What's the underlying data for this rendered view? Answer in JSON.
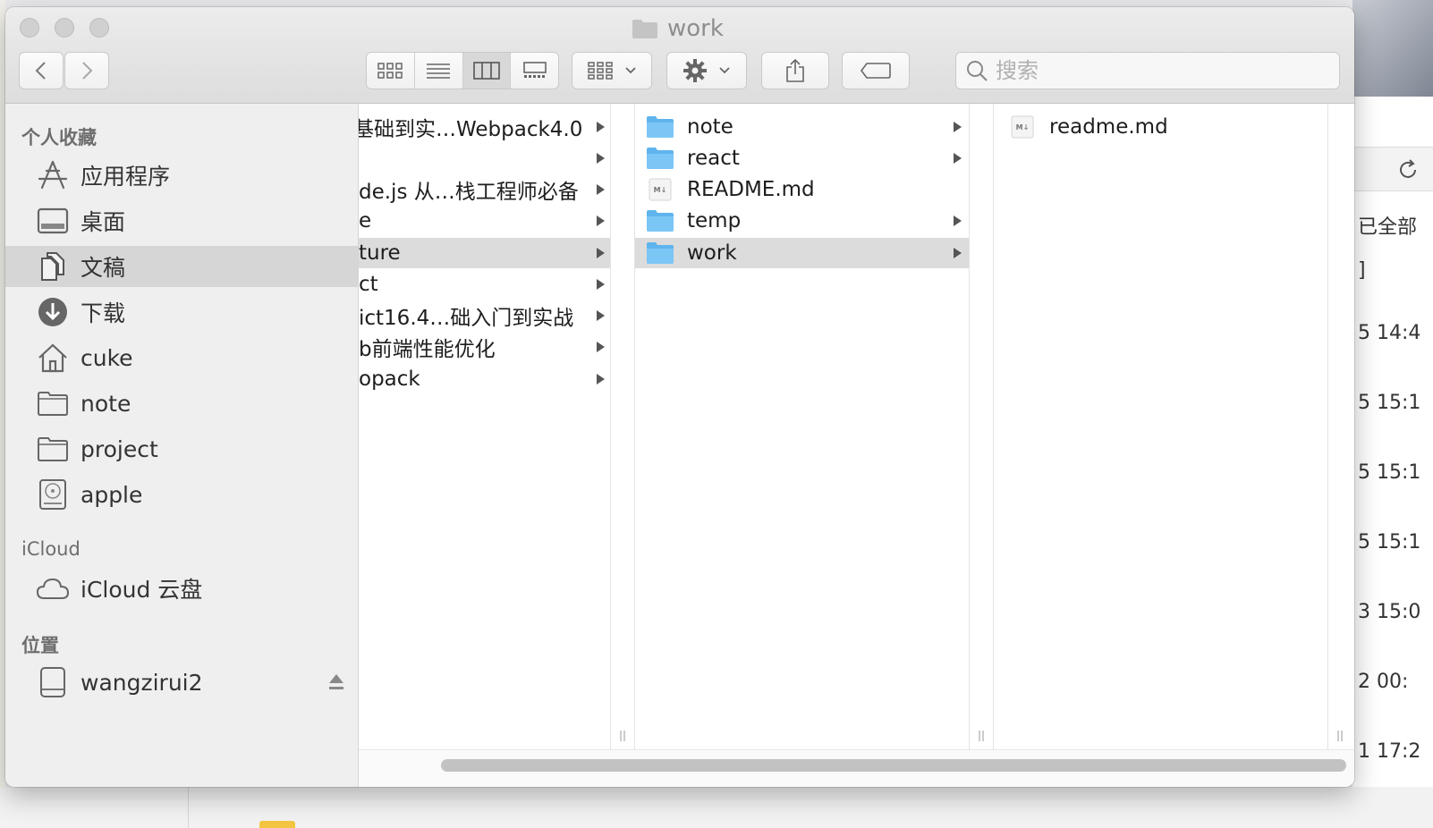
{
  "window": {
    "title": "work",
    "search_placeholder": "搜索"
  },
  "sidebar": {
    "favorites_header": "个人收藏",
    "favorites": [
      {
        "label": "应用程序",
        "icon": "applications-icon"
      },
      {
        "label": "桌面",
        "icon": "desktop-icon"
      },
      {
        "label": "文稿",
        "icon": "documents-icon",
        "selected": true
      },
      {
        "label": "下载",
        "icon": "downloads-icon"
      },
      {
        "label": "cuke",
        "icon": "home-icon"
      },
      {
        "label": "note",
        "icon": "folder-icon"
      },
      {
        "label": "project",
        "icon": "folder-icon"
      },
      {
        "label": "apple",
        "icon": "hard-drive-icon"
      }
    ],
    "icloud_header": "iCloud",
    "icloud": [
      {
        "label": "iCloud 云盘",
        "icon": "cloud-icon"
      }
    ],
    "locations_header": "位置",
    "locations": [
      {
        "label": "wangzirui2",
        "icon": "external-drive-icon"
      }
    ]
  },
  "columns": [
    {
      "items": [
        {
          "name": "基础到实…Webpack4.0",
          "arrow": true
        },
        {
          "name": "",
          "arrow": true
        },
        {
          "name": "de.js 从…栈工程师必备",
          "arrow": true
        },
        {
          "name": "e",
          "arrow": true
        },
        {
          "name": "ture",
          "arrow": true,
          "selected": true
        },
        {
          "name": "ct",
          "arrow": true
        },
        {
          "name": "ict16.4…础入门到实战",
          "arrow": true
        },
        {
          "name": "b前端性能优化",
          "arrow": true
        },
        {
          "name": "opack",
          "arrow": true
        }
      ]
    },
    {
      "items": [
        {
          "name": "note",
          "type": "folder",
          "arrow": true
        },
        {
          "name": "react",
          "type": "folder",
          "arrow": true
        },
        {
          "name": "README.md",
          "type": "markdown",
          "arrow": false
        },
        {
          "name": "temp",
          "type": "folder",
          "arrow": true
        },
        {
          "name": "work",
          "type": "folder",
          "arrow": true,
          "selected": true
        }
      ]
    },
    {
      "items": [
        {
          "name": "readme.md",
          "type": "markdown",
          "arrow": false
        }
      ]
    }
  ],
  "background": {
    "texts": [
      "已全部",
      "]",
      "5 14:4",
      "5 15:1",
      "5 15:1",
      "5 15:1",
      "3 15:0",
      "2 00:",
      "1 17:2"
    ]
  }
}
